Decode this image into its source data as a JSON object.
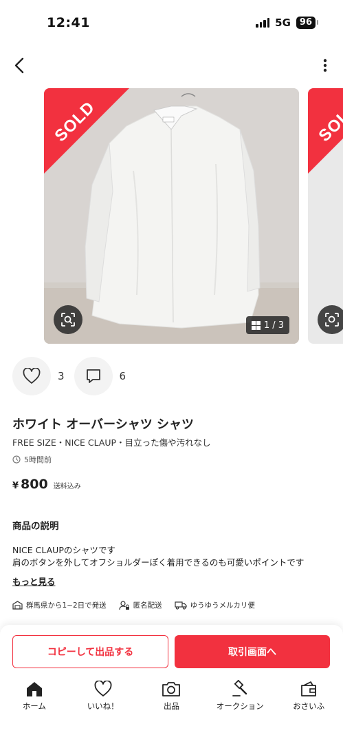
{
  "status_bar": {
    "time": "12:41",
    "network": "5G",
    "battery": "96"
  },
  "gallery": {
    "sold_label": "SOLD",
    "second_sold_label": "SOLD",
    "counter": "1 / 3",
    "current": 1,
    "total": 3
  },
  "social": {
    "likes": "3",
    "comments": "6"
  },
  "item": {
    "title": "ホワイト オーバーシャツ シャツ",
    "subinfo": "FREE SIZE・NICE CLAUP・目立った傷や汚れなし",
    "posted": "5時間前",
    "price_symbol": "¥",
    "price": "800",
    "shipping_note": "送料込み"
  },
  "description": {
    "heading": "商品の説明",
    "line1": "NICE CLAUPのシャツです",
    "line2": "肩のボタンを外してオフショルダーぽく着用できるのも可愛いポイントです",
    "more_link": "もっと見る"
  },
  "shipping": {
    "origin": "群馬県から1~2日で発送",
    "anonymous": "匿名配送",
    "method": "ゆうゆうメルカリ便"
  },
  "actions": {
    "copy_button": "コピーして出品する",
    "deal_button": "取引画面へ"
  },
  "tabs": [
    {
      "label": "ホーム",
      "icon": "home-icon"
    },
    {
      "label": "いいね！",
      "icon": "heart-icon"
    },
    {
      "label": "出品",
      "icon": "camera-icon"
    },
    {
      "label": "オークション",
      "icon": "gavel-icon"
    },
    {
      "label": "おさいふ",
      "icon": "wallet-icon"
    }
  ],
  "colors": {
    "accent": "#f2313f",
    "text": "#222222"
  }
}
